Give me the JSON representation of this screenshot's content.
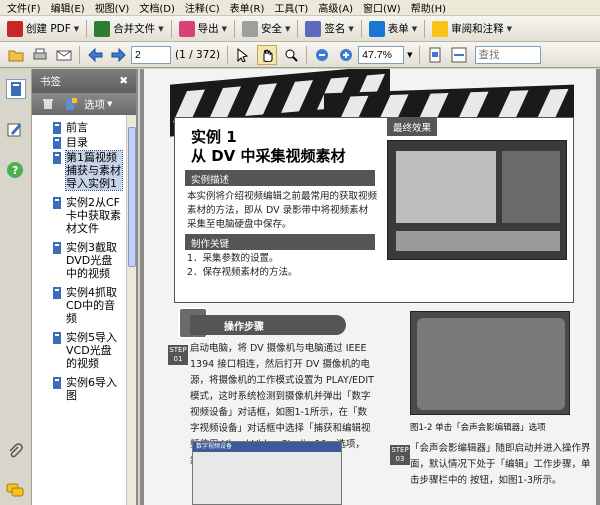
{
  "menu": [
    "文件(F)",
    "编辑(E)",
    "视图(V)",
    "文档(D)",
    "注释(C)",
    "表单(R)",
    "工具(T)",
    "高级(A)",
    "窗口(W)",
    "帮助(H)"
  ],
  "toolbar": {
    "create_pdf": "创建 PDF",
    "combine": "合并文件",
    "export": "导出",
    "secure": "安全",
    "sign": "签名",
    "forms": "表单",
    "review": "审阅和注释"
  },
  "nav": {
    "page_value": "2",
    "page_count": "(1 / 372)",
    "zoom_value": "47.7%",
    "search_placeholder": "查找"
  },
  "bookmarks": {
    "title": "书签",
    "options_label": "选项",
    "items": [
      {
        "label": "前言"
      },
      {
        "label": "目录"
      },
      {
        "label": "第1篇视频捕获与素材导入实例1"
      },
      {
        "label": "实例2从CF卡中获取素材文件"
      },
      {
        "label": "实例3截取DVD光盘中的视频"
      },
      {
        "label": "实例4抓取CD中的音频"
      },
      {
        "label": "实例5导入VCD光盘的视频"
      },
      {
        "label": "实例6导入图"
      }
    ]
  },
  "document": {
    "example_label": "实例 1",
    "example_title": "从 DV 中采集视频素材",
    "desc_header": "实例描述",
    "desc_text": "本实例将介绍视频编辑之前最常用的获取视频素材的方法，即从 DV 录影带中将视频素材采集至电脑硬盘中保存。",
    "key_header": "制作关键",
    "key_steps": [
      "1．采集参数的设置。",
      "2．保存视频素材的方法。"
    ],
    "effect_label": "最终效果",
    "op_header": "操作步骤",
    "step1_no": "STEP 01",
    "step1_text": "启动电脑，将 DV 摄像机与电脑通过 IEEE 1394 接口相连，然后打开 DV 摄像机的电源，将摄像机的工作模式设置为 PLAY/EDIT 模式，这时系统检测到摄像机并弹出「数字视频设备」对话框，如图1-1所示，在「数字视频设备」对话框中选择「捕获和编辑视频使用 Ulead Video Studio 10」选项，然后单击 按钮。",
    "dialog_title": "数字视频设备",
    "caption": "图1-2  单击「会声会影编辑器」选项",
    "step2_no": "STEP 03",
    "step2_text": "「会声会影编辑器」随即启动并进入操作界面，默认情况下处于「编辑」工作步骤，单击步骤栏中的 按钮，如图1-3所示。"
  }
}
